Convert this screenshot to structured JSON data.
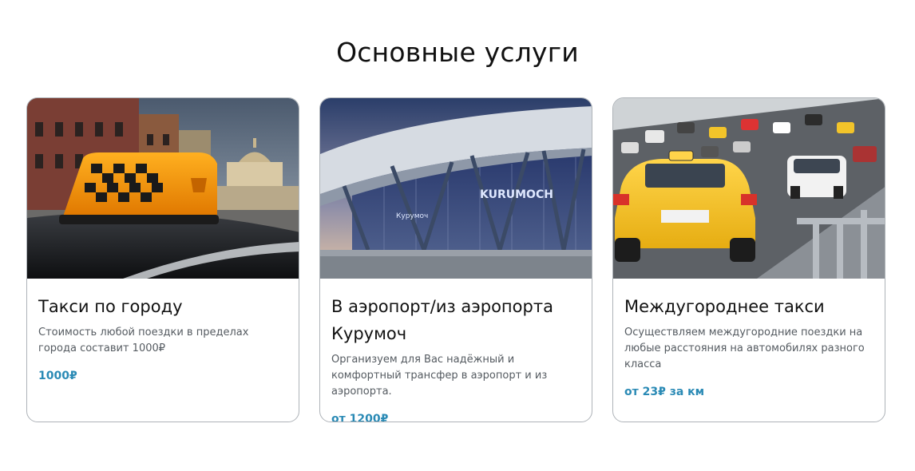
{
  "section": {
    "title": "Основные услуги"
  },
  "cards": [
    {
      "title": "Такси по городу",
      "description": "Стоимость любой поездки в пределах города составит 1000₽",
      "price": "1000₽"
    },
    {
      "title": "В аэропорт/из аэропорта Курумоч",
      "description": "Организуем для Вас надёжный и комфортный трансфер в аэропорт и из аэропорта.",
      "price": "от 1200₽"
    },
    {
      "title": "Междугороднее такси",
      "description": "Осуществляем междугородние поездки на любые расстояния на автомобилях разного класса",
      "price": "от 23₽ за км"
    }
  ],
  "images": {
    "airport_sign": "KURUMOCH",
    "airport_sign_small": "Курумоч"
  },
  "colors": {
    "accent": "#2a8ab5",
    "taxi_yellow": "#f5a623",
    "border": "#aeb3b8"
  }
}
